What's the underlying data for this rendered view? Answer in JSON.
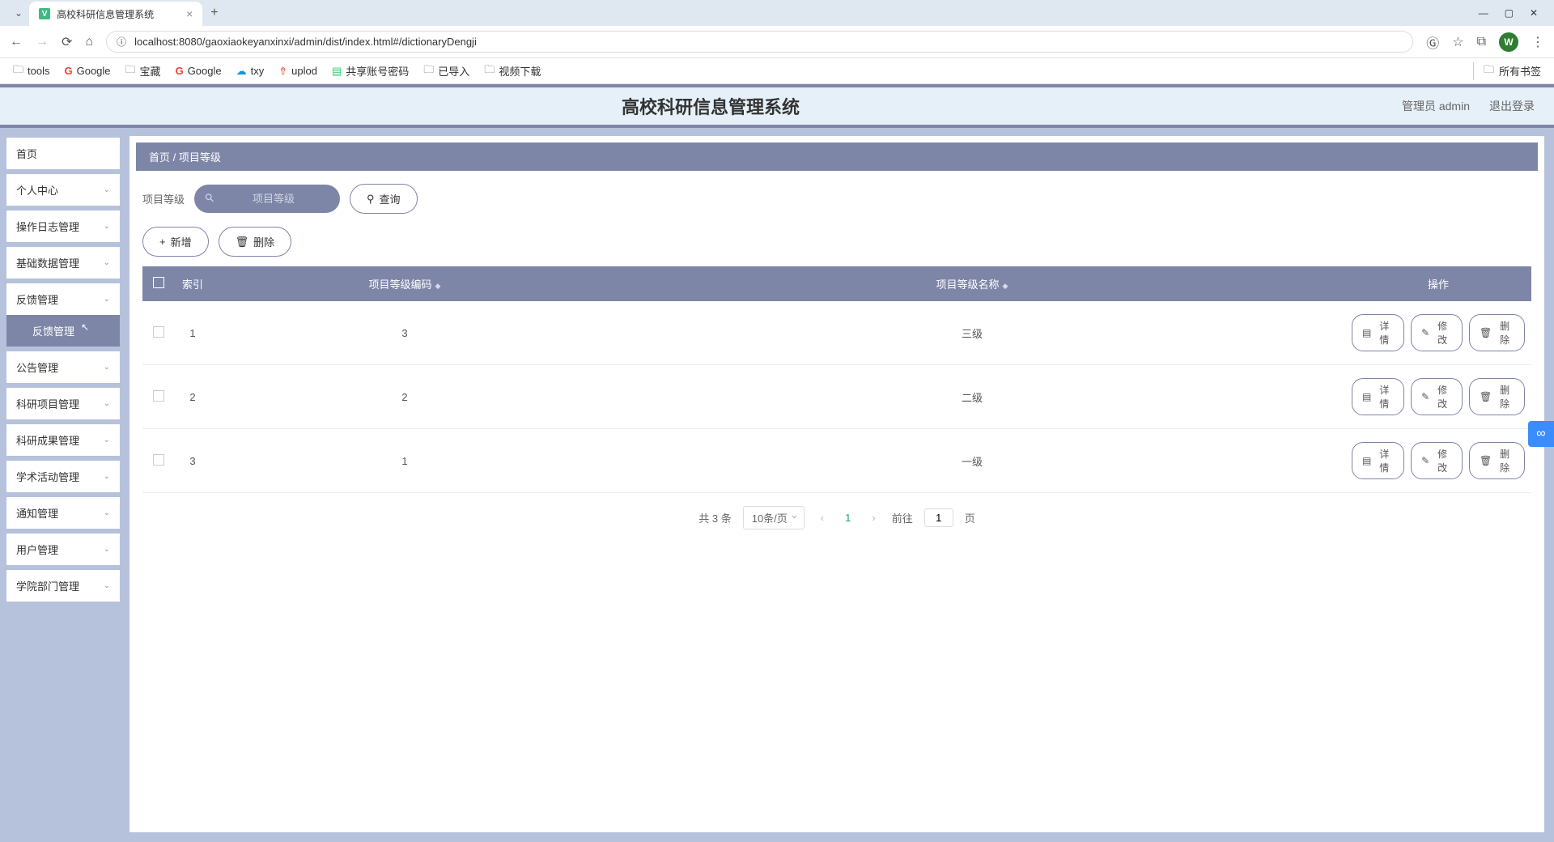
{
  "browser": {
    "tab_title": "高校科研信息管理系统",
    "url": "localhost:8080/gaoxiaokeyanxinxi/admin/dist/index.html#/dictionaryDengji",
    "avatar_letter": "W",
    "bookmarks": [
      "tools",
      "Google",
      "宝藏",
      "Google",
      "txy",
      "uplod",
      "共享账号密码",
      "已导入",
      "视频下载"
    ],
    "all_bookmarks": "所有书签"
  },
  "header": {
    "app_title": "高校科研信息管理系统",
    "user_role": "管理员 admin",
    "logout": "退出登录"
  },
  "sidebar": {
    "items": [
      {
        "label": "首页",
        "expandable": false
      },
      {
        "label": "个人中心",
        "expandable": true
      },
      {
        "label": "操作日志管理",
        "expandable": true
      },
      {
        "label": "基础数据管理",
        "expandable": true
      },
      {
        "label": "反馈管理",
        "expandable": true,
        "expanded": true,
        "children": [
          {
            "label": "反馈管理"
          }
        ]
      },
      {
        "label": "公告管理",
        "expandable": true
      },
      {
        "label": "科研项目管理",
        "expandable": true
      },
      {
        "label": "科研成果管理",
        "expandable": true
      },
      {
        "label": "学术活动管理",
        "expandable": true
      },
      {
        "label": "通知管理",
        "expandable": true
      },
      {
        "label": "用户管理",
        "expandable": true
      },
      {
        "label": "学院部门管理",
        "expandable": true
      }
    ]
  },
  "breadcrumb": {
    "home": "首页",
    "sep": " / ",
    "current": "项目等级"
  },
  "search": {
    "label": "项目等级",
    "placeholder": "项目等级",
    "button": "查询"
  },
  "actions": {
    "add": "新增",
    "delete": "删除"
  },
  "table": {
    "headers": {
      "index": "索引",
      "code": "项目等级编码",
      "name": "项目等级名称",
      "ops": "操作"
    },
    "row_actions": {
      "detail": "详情",
      "edit": "修改",
      "delete": "删除"
    },
    "rows": [
      {
        "index": "1",
        "code": "3",
        "name": "三级"
      },
      {
        "index": "2",
        "code": "2",
        "name": "二级"
      },
      {
        "index": "3",
        "code": "1",
        "name": "一级"
      }
    ]
  },
  "pagination": {
    "total": "共 3 条",
    "per_page": "10条/页",
    "current": "1",
    "goto_prefix": "前往",
    "goto_value": "1",
    "goto_suffix": "页"
  }
}
